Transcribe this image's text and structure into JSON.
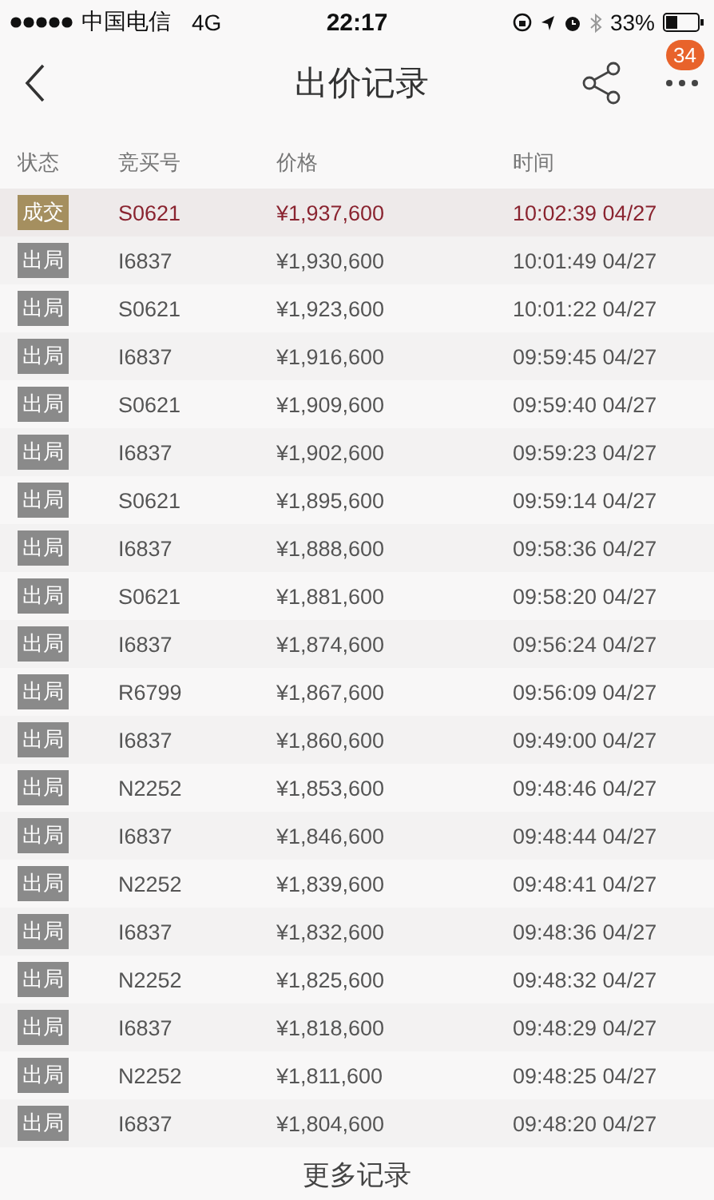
{
  "status_bar": {
    "carrier": "中国电信",
    "network": "4G",
    "time": "22:17",
    "battery": "33%"
  },
  "nav": {
    "title": "出价记录",
    "badge": "34"
  },
  "table": {
    "columns": [
      "状态",
      "竞买号",
      "价格",
      "时间"
    ],
    "rows": [
      {
        "kind": "deal",
        "status": "成交",
        "bidder": "S0621",
        "price": "¥1,937,600",
        "time": "10:02:39 04/27"
      },
      {
        "kind": "outbid",
        "status": "出局",
        "bidder": "I6837",
        "price": "¥1,930,600",
        "time": "10:01:49 04/27"
      },
      {
        "kind": "outbid",
        "status": "出局",
        "bidder": "S0621",
        "price": "¥1,923,600",
        "time": "10:01:22 04/27"
      },
      {
        "kind": "outbid",
        "status": "出局",
        "bidder": "I6837",
        "price": "¥1,916,600",
        "time": "09:59:45 04/27"
      },
      {
        "kind": "outbid",
        "status": "出局",
        "bidder": "S0621",
        "price": "¥1,909,600",
        "time": "09:59:40 04/27"
      },
      {
        "kind": "outbid",
        "status": "出局",
        "bidder": "I6837",
        "price": "¥1,902,600",
        "time": "09:59:23 04/27"
      },
      {
        "kind": "outbid",
        "status": "出局",
        "bidder": "S0621",
        "price": "¥1,895,600",
        "time": "09:59:14 04/27"
      },
      {
        "kind": "outbid",
        "status": "出局",
        "bidder": "I6837",
        "price": "¥1,888,600",
        "time": "09:58:36 04/27"
      },
      {
        "kind": "outbid",
        "status": "出局",
        "bidder": "S0621",
        "price": "¥1,881,600",
        "time": "09:58:20 04/27"
      },
      {
        "kind": "outbid",
        "status": "出局",
        "bidder": "I6837",
        "price": "¥1,874,600",
        "time": "09:56:24 04/27"
      },
      {
        "kind": "outbid",
        "status": "出局",
        "bidder": "R6799",
        "price": "¥1,867,600",
        "time": "09:56:09 04/27"
      },
      {
        "kind": "outbid",
        "status": "出局",
        "bidder": "I6837",
        "price": "¥1,860,600",
        "time": "09:49:00 04/27"
      },
      {
        "kind": "outbid",
        "status": "出局",
        "bidder": "N2252",
        "price": "¥1,853,600",
        "time": "09:48:46 04/27"
      },
      {
        "kind": "outbid",
        "status": "出局",
        "bidder": "I6837",
        "price": "¥1,846,600",
        "time": "09:48:44 04/27"
      },
      {
        "kind": "outbid",
        "status": "出局",
        "bidder": "N2252",
        "price": "¥1,839,600",
        "time": "09:48:41 04/27"
      },
      {
        "kind": "outbid",
        "status": "出局",
        "bidder": "I6837",
        "price": "¥1,832,600",
        "time": "09:48:36 04/27"
      },
      {
        "kind": "outbid",
        "status": "出局",
        "bidder": "N2252",
        "price": "¥1,825,600",
        "time": "09:48:32 04/27"
      },
      {
        "kind": "outbid",
        "status": "出局",
        "bidder": "I6837",
        "price": "¥1,818,600",
        "time": "09:48:29 04/27"
      },
      {
        "kind": "outbid",
        "status": "出局",
        "bidder": "N2252",
        "price": "¥1,811,600",
        "time": "09:48:25 04/27"
      },
      {
        "kind": "outbid",
        "status": "出局",
        "bidder": "I6837",
        "price": "¥1,804,600",
        "time": "09:48:20 04/27"
      }
    ]
  },
  "more_link": "更多记录"
}
